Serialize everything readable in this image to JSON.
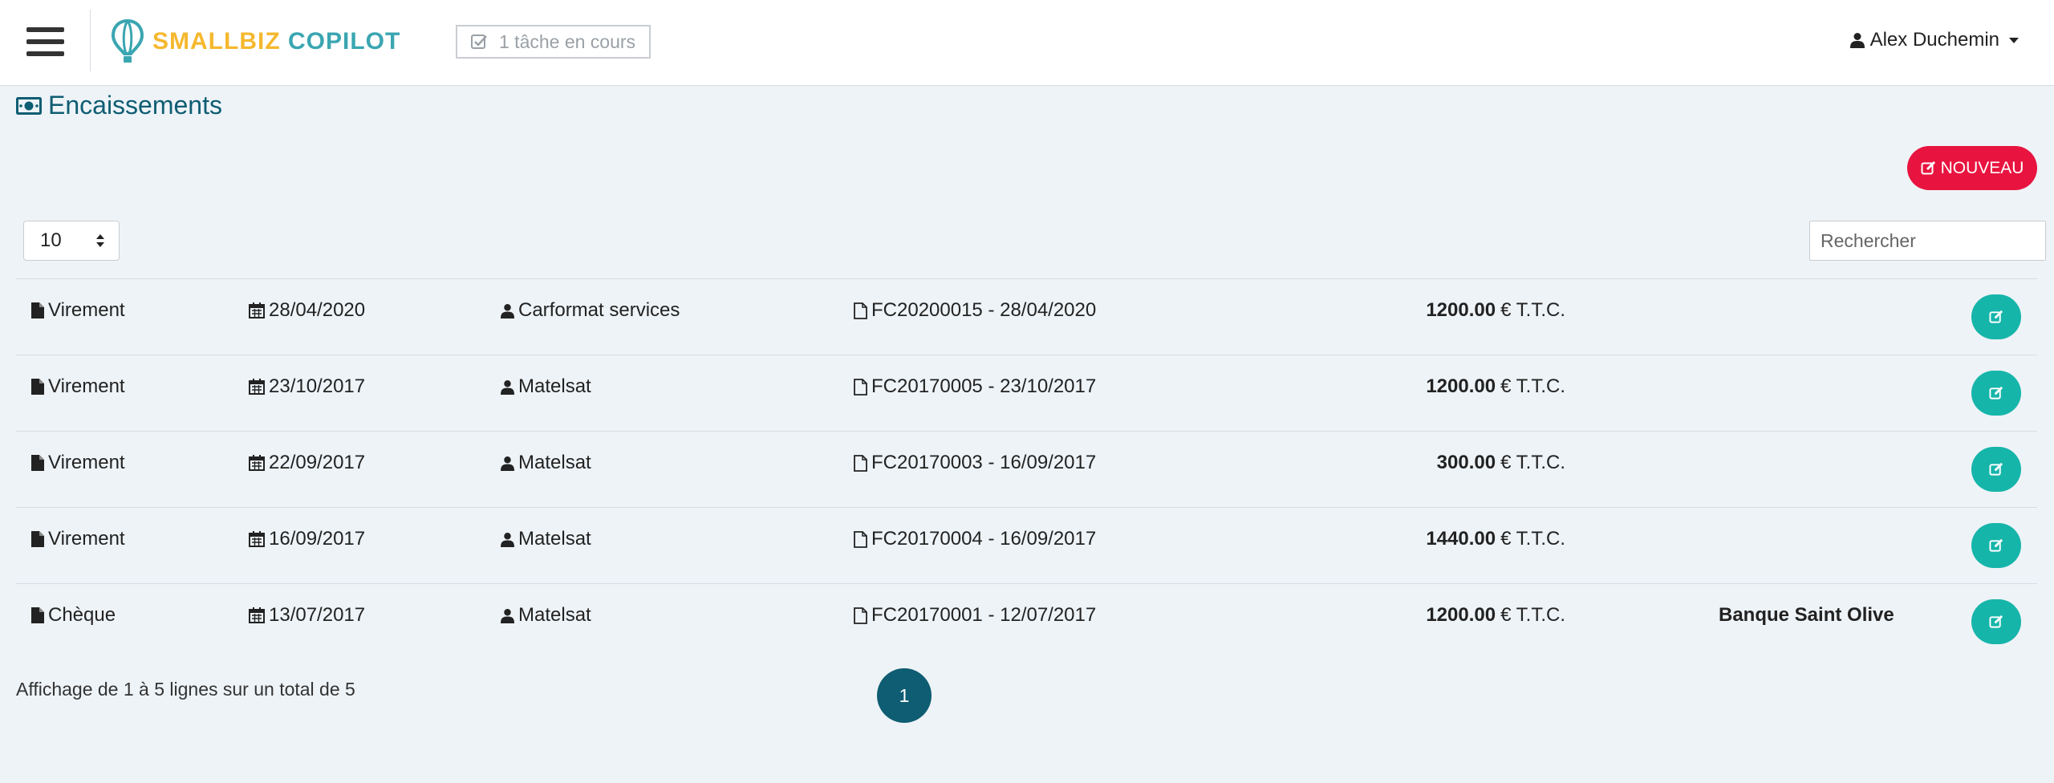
{
  "header": {
    "logo_part1": "SMALLBIZ",
    "logo_part2": "COPILOT",
    "task_status": "1 tâche en cours",
    "user_name": "Alex Duchemin"
  },
  "page": {
    "title": "Encaissements",
    "new_button": "NOUVEAU",
    "page_length": "10",
    "search_placeholder": "Rechercher",
    "info": "Affichage de 1 à 5 lignes sur un total de 5",
    "current_page": "1"
  },
  "table": {
    "rows": [
      {
        "type": "Virement",
        "date": "28/04/2020",
        "client": "Carformat services",
        "invoice": "FC20200015 - 28/04/2020",
        "amount": "1200.00",
        "currency": "€ T.T.C.",
        "bank": ""
      },
      {
        "type": "Virement",
        "date": "23/10/2017",
        "client": "Matelsat",
        "invoice": "FC20170005 - 23/10/2017",
        "amount": "1200.00",
        "currency": "€ T.T.C.",
        "bank": ""
      },
      {
        "type": "Virement",
        "date": "22/09/2017",
        "client": "Matelsat",
        "invoice": "FC20170003 - 16/09/2017",
        "amount": "300.00",
        "currency": "€ T.T.C.",
        "bank": ""
      },
      {
        "type": "Virement",
        "date": "16/09/2017",
        "client": "Matelsat",
        "invoice": "FC20170004 - 16/09/2017",
        "amount": "1440.00",
        "currency": "€ T.T.C.",
        "bank": ""
      },
      {
        "type": "Chèque",
        "date": "13/07/2017",
        "client": "Matelsat",
        "invoice": "FC20170001 - 12/07/2017",
        "amount": "1200.00",
        "currency": "€ T.T.C.",
        "bank": "Banque Saint Olive"
      }
    ]
  },
  "colors": {
    "accent": "#0e5d72",
    "new_button": "#e8143f",
    "edit_button": "#16b5aa",
    "logo_yellow": "#f5b82e",
    "logo_teal": "#3aa6b1"
  },
  "icons": {
    "menu": "hamburger-icon",
    "logo": "balloon-icon",
    "task": "check-square-icon",
    "user": "user-icon",
    "title": "money-icon",
    "new": "edit-icon",
    "type": "file-icon",
    "date": "calendar-icon",
    "client": "user-icon",
    "invoice": "file-outline-icon",
    "edit": "edit-icon"
  }
}
